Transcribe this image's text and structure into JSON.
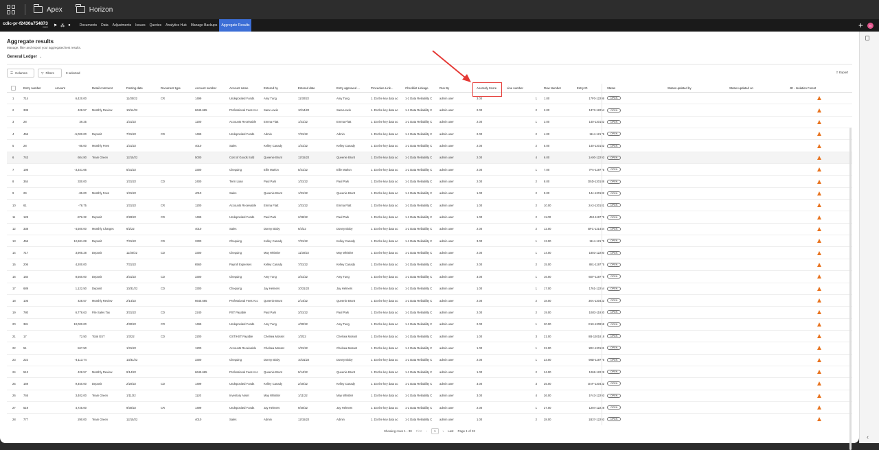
{
  "topbar": {
    "crumbs": [
      "Apex",
      "Horizon"
    ]
  },
  "nav": {
    "engagement_id": "cdic-pr-f2430a754873",
    "engagement_sub": "2022",
    "tabs": [
      "Documents",
      "Data",
      "Adjustments",
      "Issues",
      "Queries",
      "Analytics Hub",
      "Manage Backups",
      "Aggregate Results"
    ],
    "active_tab": "Aggregate Results",
    "avatar": "N"
  },
  "page": {
    "title": "Aggregate results",
    "subtitle": "Manage, filter and export your aggregated test results.",
    "dataset": "General Ledger"
  },
  "toolbar": {
    "columns": "Columns",
    "filters": "Filters",
    "selected": "0 selected",
    "export": "Export"
  },
  "columns": [
    "Entry number",
    "Amount",
    "Detail comment",
    "Posting date",
    "Document type",
    "Account number",
    "Account name",
    "Entered by",
    "Entered date",
    "Entry approved ...",
    "Procedure Link...",
    "Checklist Linkage",
    "Run By",
    "Anomaly Score",
    "Line number",
    "Row Number",
    "Entry ID",
    "Status",
    "Status updated by",
    "Status updated on",
    "JE - Isolation Forest"
  ],
  "rows": [
    [
      "1",
      "714",
      "6,420.00",
      "",
      "11/30/22",
      "CR",
      "1499",
      "Undeposited Funds",
      "Amy Tung",
      "11/30/22",
      "Amy Tung",
      "1. Do the key data ac",
      "1-1 Data Reliability C",
      "admin user",
      "3.00",
      "1",
      "1.00",
      "17F0-12286",
      "OPEN"
    ],
    [
      "2",
      "338",
      "428.57",
      "Monthly Review",
      "10/14/22",
      "",
      "6645.665",
      "Professional Fees:Acc",
      "Sara Lewin",
      "10/14/22",
      "Sara Lewin",
      "1. Do the key data ac",
      "1-1 Data Reliability C",
      "admin user",
      "2.00",
      "2",
      "2.00",
      "1373-12254",
      "OPEN"
    ],
    [
      "3",
      "28",
      "39.25",
      "",
      "1/31/22",
      "",
      "1200",
      "Accounts Receivable",
      "Emma Flatt",
      "1/31/22",
      "Emma Flatt",
      "1. Do the key data ac",
      "1-1 Data Reliability C",
      "admin user",
      "2.00",
      "1",
      "3.00",
      "140-120182",
      "OPEN"
    ],
    [
      "4",
      "456",
      "-5,000.00",
      "Deposit",
      "7/31/22",
      "CD",
      "1499",
      "Undeposited Funds",
      "Admin",
      "7/31/22",
      "Admin",
      "1. Do the key data ac",
      "1-1 Data Reliability C",
      "admin user",
      "2.00",
      "2",
      "4.00",
      "1114-12175",
      "OPEN"
    ],
    [
      "5",
      "28",
      "-85.00",
      "Monthly Fees",
      "1/31/22",
      "",
      "4010",
      "Sales",
      "Kelley Canady",
      "1/31/22",
      "Kelley Canady",
      "1. Do the key data ac",
      "1-1 Data Reliability C",
      "admin user",
      "2.00",
      "2",
      "5.00",
      "140-120182",
      "OPEN"
    ],
    [
      "6",
      "743",
      "604.80",
      "Team Green",
      "12/15/22",
      "",
      "5000",
      "Cost of Goods Sold",
      "Queenie Brunt",
      "12/15/22",
      "Queenie Brunt",
      "1. Do the key data ac",
      "1-1 Data Reliability C",
      "admin user",
      "2.00",
      "4",
      "6.00",
      "1A00-12293",
      "OPEN"
    ],
    [
      "7",
      "198",
      "-3,341.66",
      "",
      "5/31/22",
      "",
      "3300",
      "Chequing",
      "Ellie Marlon",
      "5/31/22",
      "Ellie Marlon",
      "1. Do the key data ac",
      "1-1 Data Reliability C",
      "admin user",
      "2.00",
      "1",
      "7.00",
      "7FA-119775",
      "OPEN"
    ],
    [
      "8",
      "364",
      "330.00",
      "",
      "1/31/22",
      "CD",
      "2400",
      "Term Loan",
      "Paul Park",
      "1/31/22",
      "Paul Park",
      "1. Do the key data ac",
      "1-1 Data Reliability C",
      "admin user",
      "2.00",
      "2",
      "8.00",
      "D5D-120188",
      "OPEN"
    ],
    [
      "9",
      "29",
      "-85.00",
      "Monthly Fees",
      "1/31/22",
      "",
      "4010",
      "Sales",
      "Queenie Brunt",
      "1/31/22",
      "Queenie Brunt",
      "1. Do the key data ac",
      "1-1 Data Reliability C",
      "admin user",
      "1.00",
      "2",
      "9.00",
      "144-120182",
      "OPEN"
    ],
    [
      "10",
      "61",
      "-78.75",
      "",
      "1/31/22",
      "CR",
      "1200",
      "Accounts Receivable",
      "Emma Flatt",
      "1/31/22",
      "Emma Flatt",
      "1. Do the key data ac",
      "1-1 Data Reliability C",
      "admin user",
      "1.00",
      "2",
      "10.00",
      "2A3-120181",
      "OPEN"
    ],
    [
      "11",
      "128",
      "-976.32",
      "Deposit",
      "2/28/22",
      "CD",
      "1499",
      "Undeposited Funds",
      "Paul Park",
      "2/28/22",
      "Paul Park",
      "1. Do the key data ac",
      "1-1 Data Reliability C",
      "admin user",
      "1.00",
      "2",
      "11.00",
      "453-119775",
      "OPEN"
    ],
    [
      "12",
      "338",
      "-4,500.00",
      "Monthly Charges",
      "6/2/22",
      "",
      "4010",
      "Sales",
      "Donny Bixby",
      "6/2/22",
      "Donny Bixby",
      "1. Do the key data ac",
      "1-1 Data Reliability C",
      "admin user",
      "2.00",
      "2",
      "12.00",
      "BFC-121484",
      "OPEN"
    ],
    [
      "13",
      "456",
      "12,681.08",
      "Deposit",
      "7/31/22",
      "CD",
      "3300",
      "Chequing",
      "Kelley Canady",
      "7/31/22",
      "Kelley Canady",
      "1. Do the key data ac",
      "1-1 Data Reliability C",
      "admin user",
      "3.00",
      "1",
      "13.00",
      "1114-12175",
      "OPEN"
    ],
    [
      "14",
      "717",
      "3,905.28",
      "Deposit",
      "11/30/22",
      "CD",
      "3300",
      "Chequing",
      "May Whistler",
      "11/30/22",
      "May Whistler",
      "1. Do the key data ac",
      "1-1 Data Reliability C",
      "admin user",
      "2.00",
      "1",
      "14.00",
      "1803-12280",
      "OPEN"
    ],
    [
      "15",
      "206",
      "4,200.00",
      "",
      "7/31/22",
      "",
      "6560",
      "Payroll Expenses",
      "Kelley Canady",
      "7/31/22",
      "Kelley Canady",
      "1. Do the key data ac",
      "1-1 Data Reliability C",
      "admin user",
      "2.00",
      "2",
      "15.00",
      "881-119775",
      "OPEN"
    ],
    [
      "16",
      "184",
      "8,560.00",
      "Deposit",
      "3/31/22",
      "CD",
      "3300",
      "Chequing",
      "Amy Tung",
      "3/31/22",
      "Amy Tung",
      "1. Do the key data ac",
      "1-1 Data Reliability C",
      "admin user",
      "3.00",
      "1",
      "16.00",
      "6EF-119775",
      "OPEN"
    ],
    [
      "17",
      "689",
      "1,122.50",
      "Deposit",
      "10/31/22",
      "CD",
      "3300",
      "Chequing",
      "Jay Helmers",
      "10/31/22",
      "Jay Helmers",
      "1. Do the key data ac",
      "1-1 Data Reliability C",
      "admin user",
      "1.00",
      "1",
      "17.00",
      "1761-12254",
      "OPEN"
    ],
    [
      "18",
      "105",
      "428.57",
      "Monthly Review",
      "2/14/22",
      "",
      "6645.665",
      "Professional Fees:Acc",
      "Queenie Brunt",
      "2/14/22",
      "Queenie Brunt",
      "1. Do the key data ac",
      "1-1 Data Reliability C",
      "admin user",
      "2.00",
      "2",
      "18.00",
      "36A-120432",
      "OPEN"
    ],
    [
      "19",
      "780",
      "6,778.63",
      "File Sales Tax",
      "3/31/22",
      "CD",
      "2240",
      "PST Payable",
      "Paul Park",
      "3/31/22",
      "Paul Park",
      "1. Do the key data ac",
      "1-1 Data Reliability C",
      "admin user",
      "2.00",
      "2",
      "19.00",
      "1B03-11930",
      "OPEN"
    ],
    [
      "20",
      "381",
      "10,000.00",
      "",
      "4/30/22",
      "CR",
      "1499",
      "Undeposited Funds",
      "Amy Tung",
      "4/30/22",
      "Amy Tung",
      "1. Do the key data ac",
      "1-1 Data Reliability C",
      "admin user",
      "2.00",
      "1",
      "20.00",
      "E10-120959",
      "OPEN"
    ],
    [
      "21",
      "17",
      "72.50",
      "Total GST",
      "1/3/22",
      "CD",
      "2200",
      "GST/HST Payable",
      "Chelsea Mosset",
      "1/3/22",
      "Chelsea Mosset",
      "1. Do the key data ac",
      "1-1 Data Reliability C",
      "admin user",
      "1.00",
      "3",
      "21.00",
      "8B-1201818",
      "OPEN"
    ],
    [
      "22",
      "51",
      "847.50",
      "",
      "1/31/22",
      "",
      "1200",
      "Accounts Receivable",
      "Chelsea Mosset",
      "1/31/22",
      "Chelsea Mosset",
      "1. Do the key data ac",
      "1-1 Data Reliability C",
      "admin user",
      "1.00",
      "1",
      "22.00",
      "1D2-120181",
      "OPEN"
    ],
    [
      "23",
      "222",
      "-4,113.74",
      "",
      "10/31/22",
      "",
      "3300",
      "Chequing",
      "Donny Bixby",
      "10/31/22",
      "Donny Bixby",
      "1. Do the key data ac",
      "1-1 Data Reliability C",
      "admin user",
      "2.00",
      "1",
      "23.00",
      "98D-119775",
      "OPEN"
    ],
    [
      "24",
      "513",
      "428.57",
      "Monthly Review",
      "9/14/22",
      "",
      "6645.665",
      "Professional Fees:Acc",
      "Queenie Brunt",
      "9/14/22",
      "Queenie Brunt",
      "1. Do the key data ac",
      "1-1 Data Reliability C",
      "admin user",
      "1.00",
      "2",
      "24.00",
      "1268-12228",
      "OPEN"
    ],
    [
      "25",
      "169",
      "9,450.00",
      "Deposit",
      "2/20/22",
      "CD",
      "1499",
      "Undeposited Funds",
      "Kelley Canady",
      "2/20/22",
      "Kelley Canady",
      "1. Do the key data ac",
      "1-1 Data Reliability C",
      "admin user",
      "3.00",
      "3",
      "25.00",
      "DAF-120432",
      "OPEN"
    ],
    [
      "26",
      "746",
      "3,402.00",
      "Team Green",
      "1/11/22",
      "",
      "1120",
      "Inventory Asset",
      "May Whistler",
      "1/11/22",
      "May Whistler",
      "1. Do the key data ac",
      "1-1 Data Reliability C",
      "admin user",
      "3.00",
      "4",
      "26.00",
      "1F43-12293",
      "OPEN"
    ],
    [
      "27",
      "519",
      "4,725.00",
      "",
      "9/30/22",
      "CR",
      "1499",
      "Undeposited Funds",
      "Jay Helmers",
      "9/30/22",
      "Jay Helmers",
      "1. Do the key data ac",
      "1-1 Data Reliability C",
      "admin user",
      "2.00",
      "1",
      "27.00",
      "1294-12228",
      "OPEN"
    ],
    [
      "28",
      "777",
      "290.00",
      "Team Green",
      "12/15/22",
      "",
      "4010",
      "Sales",
      "Admin",
      "12/15/22",
      "Admin",
      "1. Do the key data ac",
      "1-1 Data Reliability C",
      "admin user",
      "1.00",
      "2",
      "28.00",
      "1B37-12293",
      "OPEN"
    ]
  ],
  "pagination": {
    "showing": "Showing rows 1 - 30",
    "first": "First",
    "page": "1",
    "last": "Last",
    "page_of": "Page 1 of 32"
  },
  "colors": {
    "accent": "#3c6ed6",
    "highlight": "#e53935",
    "warning": "#e8731f"
  }
}
